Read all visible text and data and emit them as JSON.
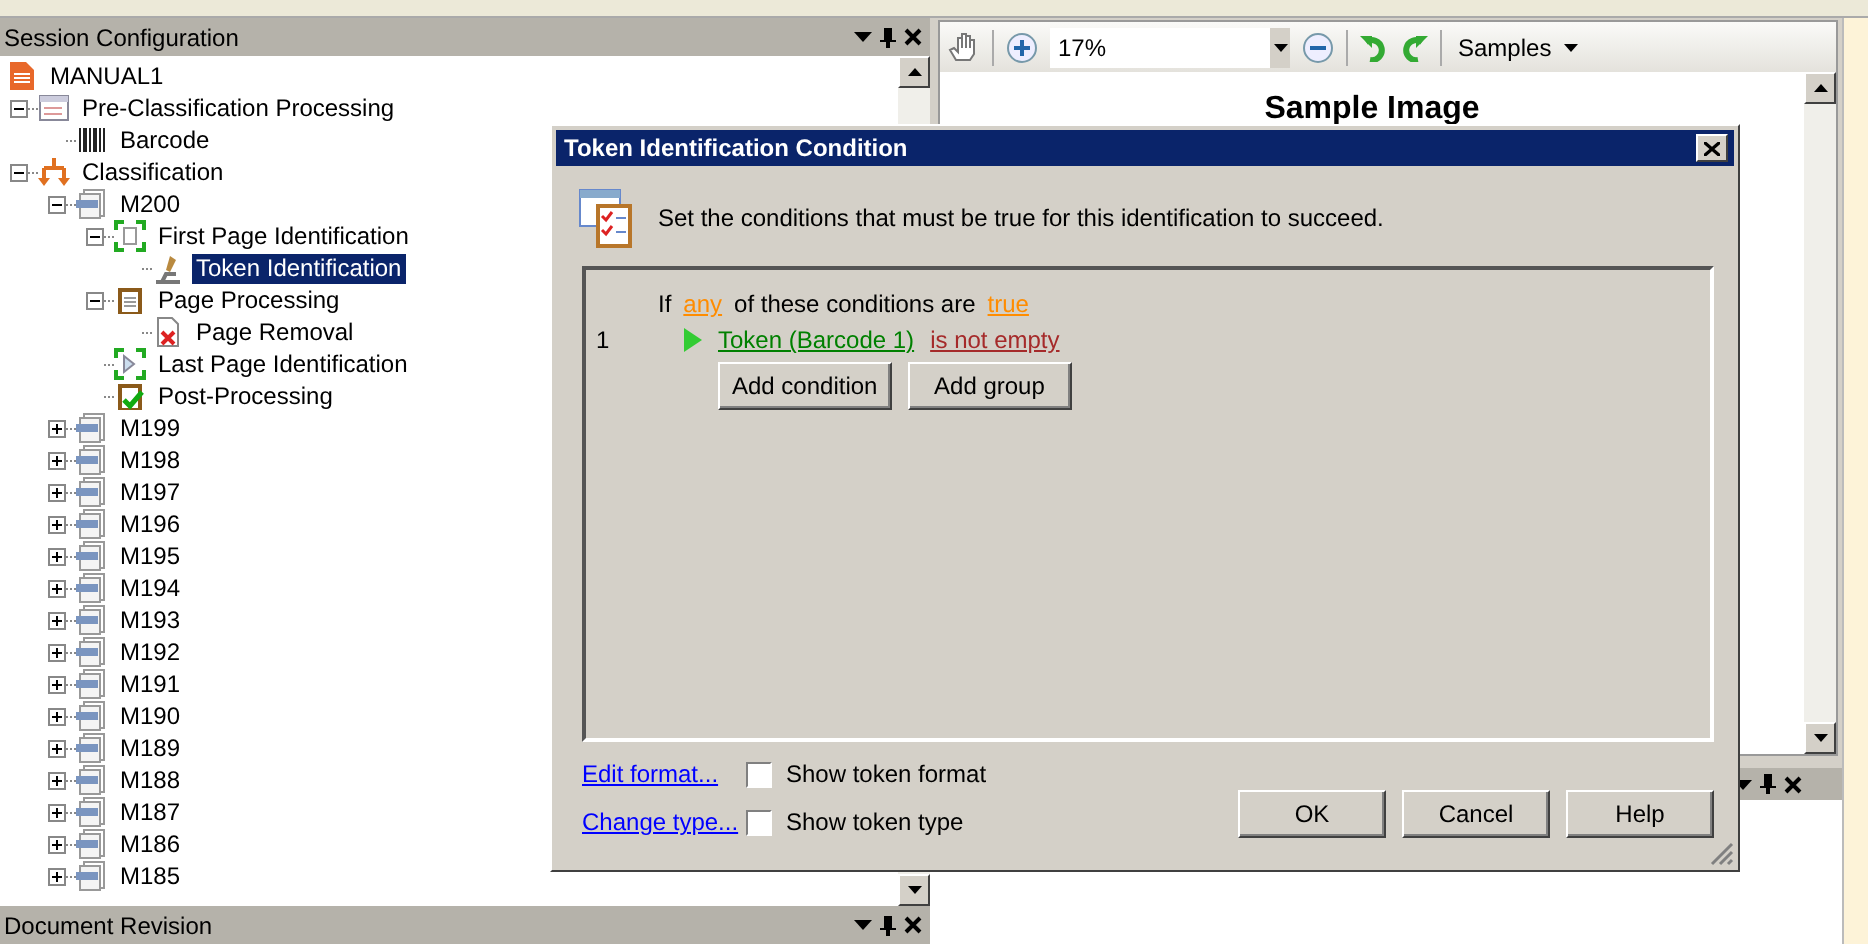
{
  "session_panel": {
    "title": "Session Configuration",
    "tree": [
      {
        "label": "MANUAL1",
        "kind": "document",
        "selected": false,
        "children": [
          {
            "label": "Pre-Classification Processing",
            "kind": "process",
            "expanded": true,
            "selected": false,
            "children": [
              {
                "label": "Barcode",
                "kind": "barcode",
                "selected": false
              }
            ]
          },
          {
            "label": "Classification",
            "kind": "classify",
            "expanded": true,
            "selected": false,
            "children": [
              {
                "label": "M200",
                "kind": "model",
                "expanded": true,
                "selected": false,
                "children": [
                  {
                    "label": "First Page Identification",
                    "kind": "page-id",
                    "expanded": true,
                    "selected": false,
                    "children": [
                      {
                        "label": "Token Identification",
                        "kind": "token",
                        "selected": true
                      }
                    ]
                  },
                  {
                    "label": "Page Processing",
                    "kind": "clipboard",
                    "expanded": true,
                    "selected": false,
                    "children": [
                      {
                        "label": "Page Removal",
                        "kind": "removal",
                        "selected": false
                      }
                    ]
                  },
                  {
                    "label": "Last Page Identification",
                    "kind": "last-page",
                    "selected": false
                  },
                  {
                    "label": "Post-Processing",
                    "kind": "post",
                    "selected": false
                  }
                ]
              },
              {
                "label": "M199",
                "kind": "model",
                "expanded": false,
                "selected": false
              },
              {
                "label": "M198",
                "kind": "model",
                "expanded": false,
                "selected": false
              },
              {
                "label": "M197",
                "kind": "model",
                "expanded": false,
                "selected": false
              },
              {
                "label": "M196",
                "kind": "model",
                "expanded": false,
                "selected": false
              },
              {
                "label": "M195",
                "kind": "model",
                "expanded": false,
                "selected": false
              },
              {
                "label": "M194",
                "kind": "model",
                "expanded": false,
                "selected": false
              },
              {
                "label": "M193",
                "kind": "model",
                "expanded": false,
                "selected": false
              },
              {
                "label": "M192",
                "kind": "model",
                "expanded": false,
                "selected": false
              },
              {
                "label": "M191",
                "kind": "model",
                "expanded": false,
                "selected": false
              },
              {
                "label": "M190",
                "kind": "model",
                "expanded": false,
                "selected": false
              },
              {
                "label": "M189",
                "kind": "model",
                "expanded": false,
                "selected": false
              },
              {
                "label": "M188",
                "kind": "model",
                "expanded": false,
                "selected": false
              },
              {
                "label": "M187",
                "kind": "model",
                "expanded": false,
                "selected": false
              },
              {
                "label": "M186",
                "kind": "model",
                "expanded": false,
                "selected": false
              },
              {
                "label": "M185",
                "kind": "model",
                "expanded": false,
                "selected": false
              }
            ]
          }
        ]
      }
    ]
  },
  "revision_panel": {
    "title": "Document Revision"
  },
  "viewer": {
    "zoom_field": {
      "value": "17%"
    },
    "samples_menu": "Samples",
    "document_title": "Sample Image"
  },
  "dialog": {
    "title": "Token Identification Condition",
    "instruction": "Set the conditions that must be true for this identification to succeed.",
    "condition_header": {
      "prefix": "If",
      "quantifier": "any",
      "middle": "of these conditions are",
      "value": "true"
    },
    "conditions": [
      {
        "number": "1",
        "token": "Token (Barcode 1)",
        "operator": "is not empty"
      }
    ],
    "group_buttons": [
      "Add condition",
      "Add group"
    ],
    "options": [
      {
        "link": "Edit format...",
        "label": "Show token format",
        "checked": false
      },
      {
        "link": "Change type...",
        "label": "Show token type",
        "checked": false
      }
    ],
    "buttons": [
      "OK",
      "Cancel",
      "Help"
    ]
  }
}
